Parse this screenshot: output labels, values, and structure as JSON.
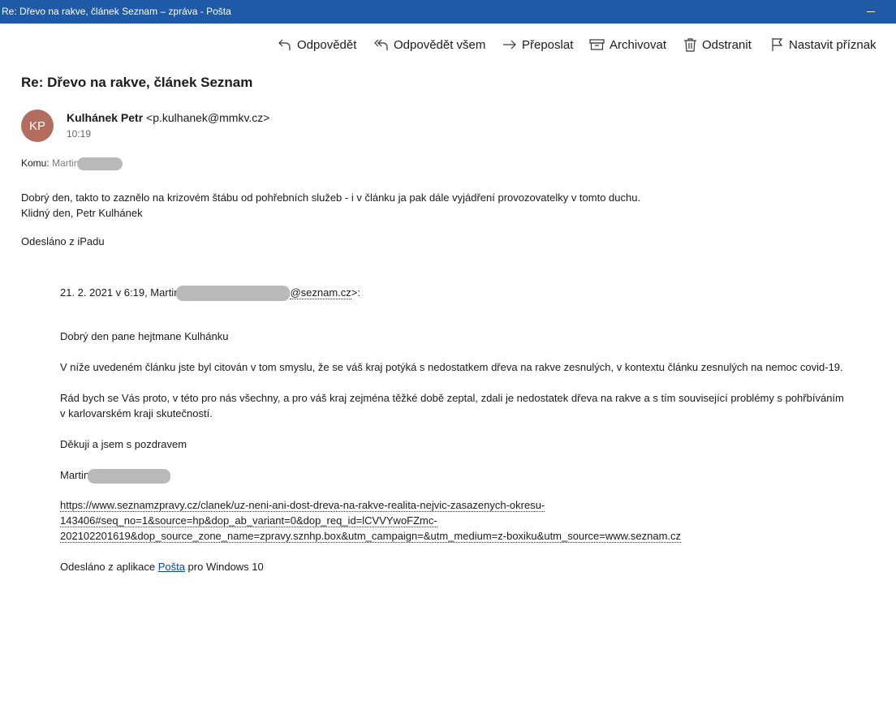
{
  "window": {
    "title": "Re: Dřevo na rakve, článek Seznam – zpráva - Pošta"
  },
  "toolbar": {
    "reply": "Odpovědět",
    "reply_all": "Odpovědět všem",
    "forward": "Přeposlat",
    "archive": "Archivovat",
    "delete": "Odstranit",
    "flag": "Nastavit příznak"
  },
  "message": {
    "subject": "Re: Dřevo na rakve, článek Seznam",
    "avatar_initials": "KP",
    "sender_name": "Kulhánek Petr",
    "sender_email": "<p.kulhanek@mmkv.cz>",
    "time": "10:19",
    "to_label": "Komu:",
    "to_name": "Martin",
    "body_line1": "Dobrý den, takto to zaznělo na krizovém štábu od pohřebních služeb - i v článku ja pak dále vyjádření provozovatelky v tomto duchu.",
    "body_line2": "Klidný den, Petr Kulhánek",
    "signature": "Odesláno z iPadu"
  },
  "quoted": {
    "header_prefix": "21. 2. 2021 v 6:19, Martin",
    "header_email_suffix": "@seznam.cz",
    "header_end": ">:",
    "greeting": "Dobrý den pane hejtmane Kulhánku",
    "para1": "V níže uvedeném článku jste byl citován v tom smyslu, že se váš kraj potýká s nedostatkem dřeva na rakve zesnulých, v kontextu článku zesnulých na nemoc covid-19.",
    "para2_line1": "Rád bych se Vás proto, v této pro nás všechny, a pro váš kraj zejména těžké době zeptal, zdali je nedostatek dřeva na rakve a s tím související problémy s pohřbíváním",
    "para2_line2": "v karlovarském kraji skutečností.",
    "closing": "Děkuji a jsem s pozdravem",
    "signoff_name": "Martin",
    "url_line1": "https://www.seznamzpravy.cz/clanek/uz-neni-ani-dost-dreva-na-rakve-realita-nejvic-zasazenych-okresu-",
    "url_line2": "143406#seq_no=1&source=hp&dop_ab_variant=0&dop_req_id=lCVVYwoFZmc-",
    "url_line3": "202102201619&dop_source_zone_name=zpravy.sznhp.box&utm_campaign=&utm_medium=z-boxiku&utm_source=www.seznam.cz",
    "sent_from_prefix": "Odesláno z aplikace ",
    "sent_from_link": "Pošta",
    "sent_from_suffix": " pro Windows 10"
  }
}
